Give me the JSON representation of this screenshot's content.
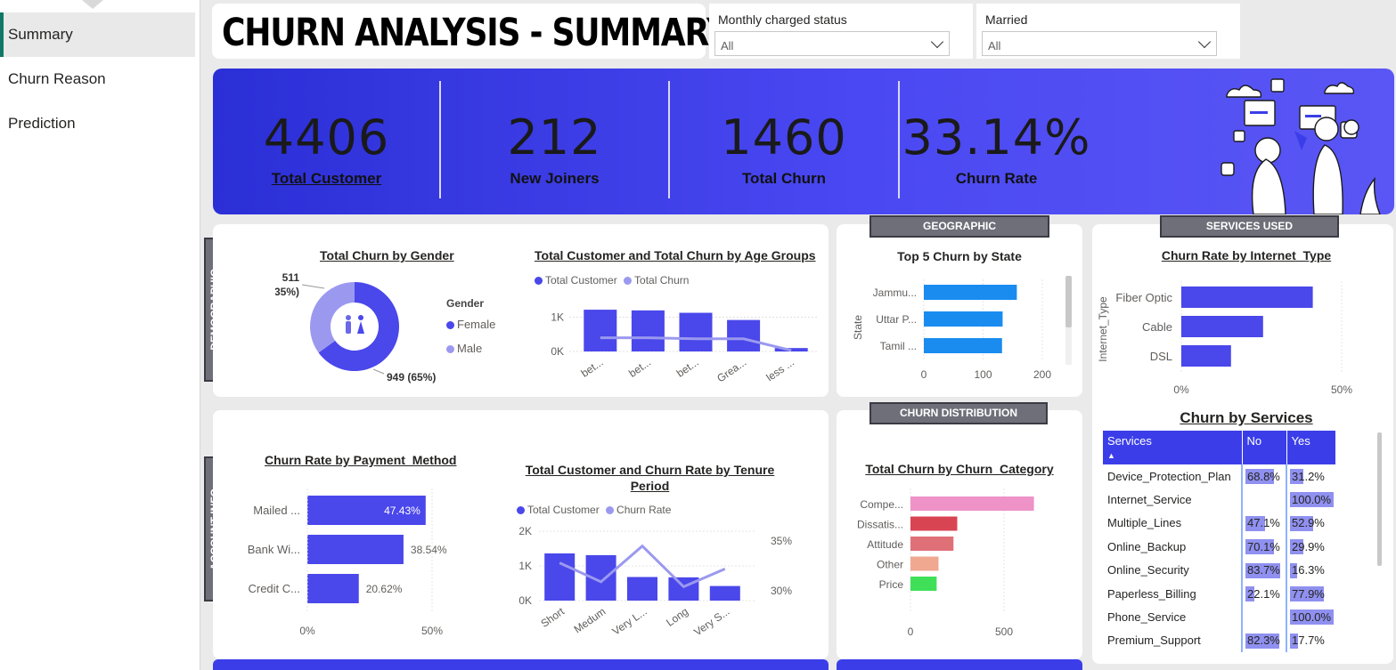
{
  "nav": {
    "items": [
      {
        "label": "Summary",
        "active": true
      },
      {
        "label": "Churn Reason",
        "active": false
      },
      {
        "label": "Prediction",
        "active": false
      }
    ]
  },
  "header": {
    "title": "CHURN ANALYSIS - SUMMARY"
  },
  "filters": [
    {
      "label": "Monthly charged status",
      "value": "All"
    },
    {
      "label": "Married",
      "value": "All"
    }
  ],
  "kpis": [
    {
      "value": "4406",
      "label": "Total Customer"
    },
    {
      "value": "212",
      "label": "New Joiners"
    },
    {
      "value": "1460",
      "label": "Total Churn"
    },
    {
      "value": "33.14%",
      "label": "Churn Rate"
    }
  ],
  "sections": {
    "demographic": "DEMOGRAPHIC",
    "account_info": "ACCOUNT INFO",
    "geographic": "GEOGRAPHIC",
    "services_used": "SERVICES USED",
    "churn_distribution": "CHURN DISTRIBUTION"
  },
  "colors": {
    "primary": "#4a47eb",
    "light": "#9b99ef",
    "kpi_band": "#3b3ee8",
    "state_bar": "#1a8cf0"
  },
  "chart_data": [
    {
      "id": "gender",
      "type": "pie",
      "title": "Total Churn by Gender",
      "legend_title": "Gender",
      "categories": [
        "Female",
        "Male"
      ],
      "values": [
        949,
        511
      ],
      "data_labels": [
        "949 (65%)",
        "511\n(35%)"
      ]
    },
    {
      "id": "age",
      "type": "bar",
      "title": "Total Customer and Total Churn by Age Groups",
      "categories": [
        "bet...",
        "bet...",
        "bet...",
        "Grea...",
        "less ..."
      ],
      "series": [
        {
          "name": "Total Customer",
          "values": [
            1220,
            1200,
            1130,
            920,
            100
          ]
        },
        {
          "name": "Total Churn",
          "values": [
            400,
            400,
            370,
            370,
            30
          ]
        }
      ],
      "yticks": [
        "0K",
        "1K"
      ],
      "ylim": [
        0,
        1300
      ]
    },
    {
      "id": "state",
      "type": "bar",
      "title": "Top 5 Churn by State",
      "ylabel": "State",
      "categories": [
        "Jammu...",
        "Uttar P...",
        "Tamil ..."
      ],
      "values": [
        157,
        133,
        132
      ],
      "xticks": [
        "0",
        "100",
        "200"
      ],
      "xlim": [
        0,
        200
      ]
    },
    {
      "id": "internet",
      "type": "bar",
      "title": "Churn Rate by Internet_Type",
      "ylabel": "Internet_Type",
      "categories": [
        "Fiber Optic",
        "Cable",
        "DSL"
      ],
      "values": [
        41,
        25.5,
        15.5
      ],
      "xticks": [
        "0%",
        "50%"
      ],
      "xlim": [
        0,
        50
      ]
    },
    {
      "id": "payment",
      "type": "bar",
      "title": "Churn Rate by Payment_Method",
      "categories": [
        "Mailed ...",
        "Bank Wi...",
        "Credit C..."
      ],
      "values": [
        47.43,
        38.54,
        20.62
      ],
      "data_labels": [
        "47.43%",
        "38.54%",
        "20.62%"
      ],
      "xticks": [
        "0%",
        "50%"
      ],
      "xlim": [
        0,
        50
      ]
    },
    {
      "id": "tenure",
      "type": "bar",
      "title": "Total Customer and Churn Rate by Tenure Period",
      "categories": [
        "Short",
        "Medum",
        "Very L...",
        "Long",
        "Very S..."
      ],
      "series": [
        {
          "name": "Total Customer",
          "values": [
            1360,
            1310,
            680,
            670,
            420
          ]
        },
        {
          "name": "Churn Rate",
          "values": [
            32.8,
            30.9,
            34.5,
            30.4,
            32.2
          ]
        }
      ],
      "yticks_left": [
        "0K",
        "1K",
        "2K"
      ],
      "yticks_right": [
        "30%",
        "35%"
      ],
      "ylim_left": [
        0,
        2000
      ],
      "ylim_right": [
        29,
        36
      ]
    },
    {
      "id": "churn_category",
      "type": "bar",
      "title": "Total Churn by Churn_Category",
      "categories": [
        "Compe...",
        "Dissatis...",
        "Attitude",
        "Other",
        "Price"
      ],
      "values": [
        660,
        250,
        230,
        150,
        140
      ],
      "colors": [
        "#ee92c8",
        "#d94452",
        "#e07078",
        "#f0a891",
        "#3fe058"
      ],
      "xticks": [
        "0",
        "500"
      ],
      "xlim": [
        0,
        700
      ]
    }
  ],
  "services_table": {
    "title": "Churn by Services",
    "columns": [
      "Services",
      "No",
      "Yes"
    ],
    "rows": [
      {
        "service": "Device_Protection_Plan",
        "no": "68.8%",
        "yes": "31.2%",
        "no_v": 68.8,
        "yes_v": 31.2
      },
      {
        "service": "Internet_Service",
        "no": "",
        "yes": "100.0%",
        "no_v": 0,
        "yes_v": 100
      },
      {
        "service": "Multiple_Lines",
        "no": "47.1%",
        "yes": "52.9%",
        "no_v": 47.1,
        "yes_v": 52.9
      },
      {
        "service": "Online_Backup",
        "no": "70.1%",
        "yes": "29.9%",
        "no_v": 70.1,
        "yes_v": 29.9
      },
      {
        "service": "Online_Security",
        "no": "83.7%",
        "yes": "16.3%",
        "no_v": 83.7,
        "yes_v": 16.3
      },
      {
        "service": "Paperless_Billing",
        "no": "22.1%",
        "yes": "77.9%",
        "no_v": 22.1,
        "yes_v": 77.9
      },
      {
        "service": "Phone_Service",
        "no": "",
        "yes": "100.0%",
        "no_v": 0,
        "yes_v": 100
      },
      {
        "service": "Premium_Support",
        "no": "82.3%",
        "yes": "17.7%",
        "no_v": 82.3,
        "yes_v": 17.7
      }
    ]
  }
}
